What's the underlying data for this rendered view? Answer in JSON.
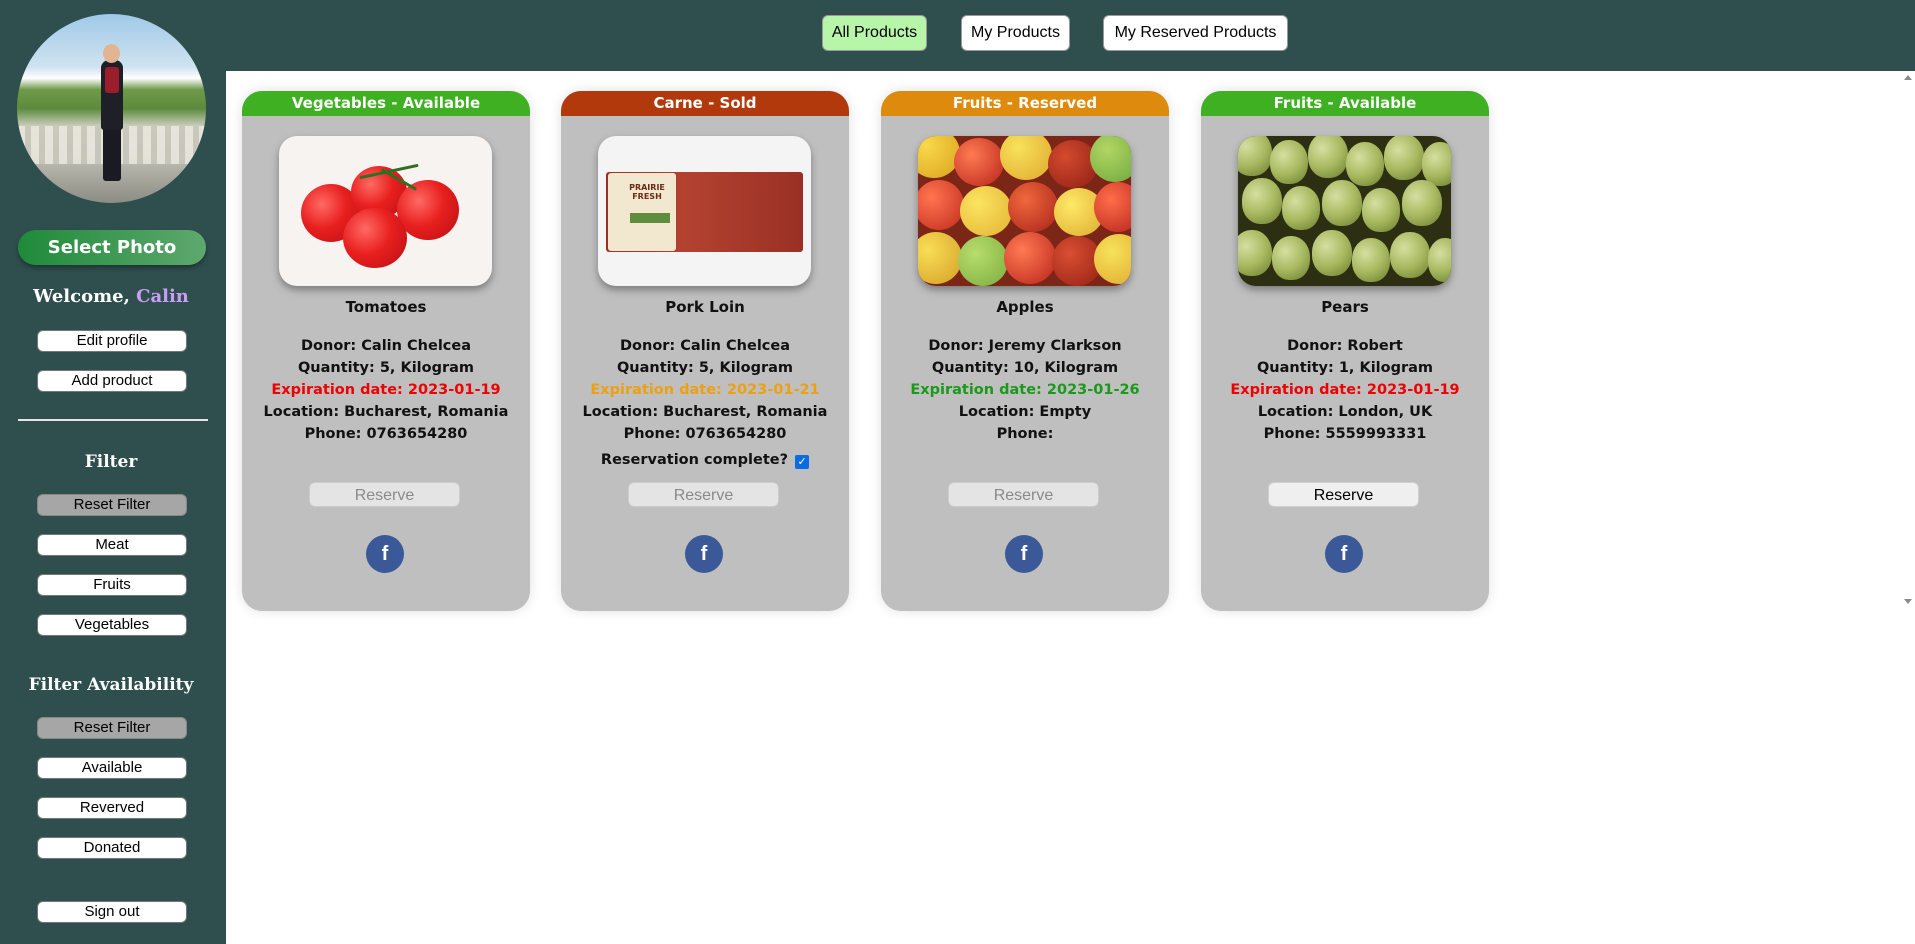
{
  "sidebar": {
    "select_photo": "Select Photo",
    "welcome_prefix": "Welcome,",
    "username": "Calin",
    "edit_profile": "Edit profile",
    "add_product": "Add product",
    "filter_heading": "Filter",
    "filter_buttons": [
      "Reset Filter",
      "Meat",
      "Fruits",
      "Vegetables"
    ],
    "availability_heading": "Filter Availability",
    "availability_buttons": [
      "Reset Filter",
      "Available",
      "Reverved",
      "Donated"
    ],
    "sign_out": "Sign out"
  },
  "nav": {
    "tabs": [
      "All Products",
      "My Products",
      "My Reserved Products"
    ],
    "active": "All Products"
  },
  "products": [
    {
      "banner": "Vegetables - Available",
      "banner_color": "#3fb022",
      "name": "Tomatoes",
      "donor": "Donor: Calin Chelcea",
      "quantity": "Quantity: 5, Kilogram",
      "expiration": "Expiration date: 2023-01-19",
      "expiration_color": "#ee0000",
      "location": "Location: Bucharest, Romania",
      "phone": "Phone: 0763654280",
      "reserve": "Reserve",
      "reserve_enabled": false
    },
    {
      "banner": "Carne - Sold",
      "banner_color": "#b2390c",
      "name": "Pork Loin",
      "donor": "Donor: Calin Chelcea",
      "quantity": "Quantity: 5, Kilogram",
      "expiration": "Expiration date: 2023-01-21",
      "expiration_color": "#eda012",
      "location": "Location: Bucharest, Romania",
      "phone": "Phone: 0763654280",
      "reservation_complete": "Reservation complete?",
      "reservation_checked": true,
      "reserve": "Reserve",
      "reserve_enabled": false,
      "package_text": "PRAIRIE FRESH"
    },
    {
      "banner": "Fruits - Reserved",
      "banner_color": "#de8a0d",
      "name": "Apples",
      "donor": "Donor: Jeremy Clarkson",
      "quantity": "Quantity: 10, Kilogram",
      "expiration": "Expiration date: 2023-01-26",
      "expiration_color": "#1a9a1a",
      "location": "Location: Empty",
      "phone": "Phone:",
      "reserve": "Reserve",
      "reserve_enabled": false
    },
    {
      "banner": "Fruits - Available",
      "banner_color": "#3fb022",
      "name": "Pears",
      "donor": "Donor: Robert",
      "quantity": "Quantity: 1, Kilogram",
      "expiration": "Expiration date: 2023-01-19",
      "expiration_color": "#ee0000",
      "location": "Location: London, UK",
      "phone": "Phone: 5559993331",
      "reserve": "Reserve",
      "reserve_enabled": true
    }
  ],
  "icons": {
    "share": "facebook-icon"
  }
}
